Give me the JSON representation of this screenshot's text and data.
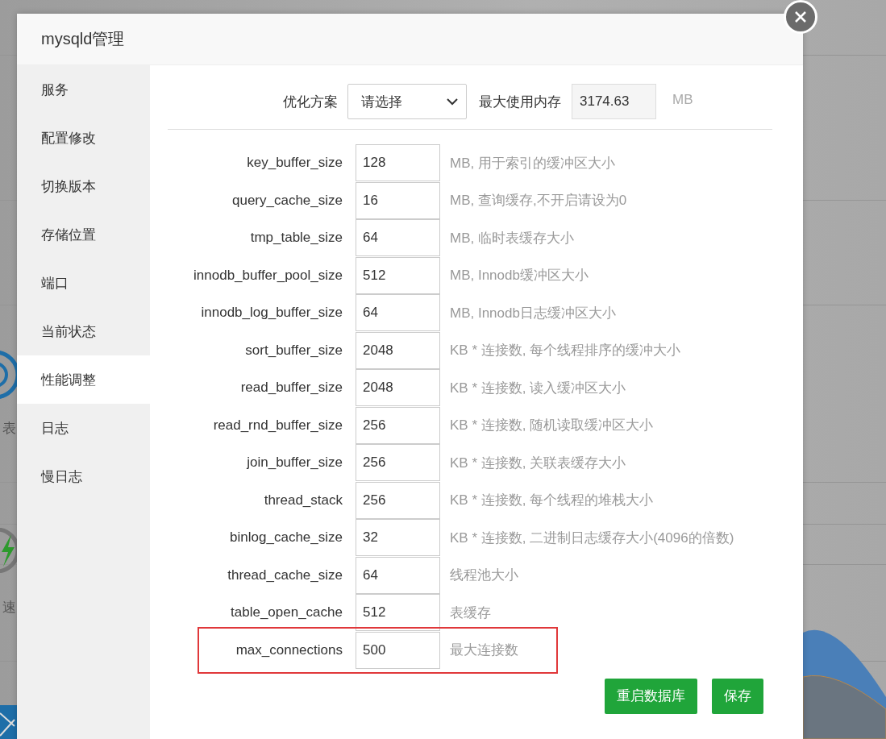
{
  "background": {
    "labels": [
      "表",
      "速"
    ]
  },
  "dialog": {
    "title": "mysqld管理"
  },
  "sidebar": {
    "items": [
      {
        "label": "服务",
        "selected": false
      },
      {
        "label": "配置修改",
        "selected": false
      },
      {
        "label": "切换版本",
        "selected": false
      },
      {
        "label": "存储位置",
        "selected": false
      },
      {
        "label": "端口",
        "selected": false
      },
      {
        "label": "当前状态",
        "selected": false
      },
      {
        "label": "性能调整",
        "selected": true
      },
      {
        "label": "日志",
        "selected": false
      },
      {
        "label": "慢日志",
        "selected": false
      }
    ]
  },
  "toolbar": {
    "scheme_label": "优化方案",
    "scheme_value": "请选择",
    "memory_label": "最大使用内存",
    "memory_value": "3174.63",
    "memory_unit": "MB"
  },
  "params": [
    {
      "name": "key_buffer_size",
      "value": "128",
      "description": "MB, 用于索引的缓冲区大小",
      "highlighted": false
    },
    {
      "name": "query_cache_size",
      "value": "16",
      "description": "MB, 查询缓存,不开启请设为0",
      "highlighted": false
    },
    {
      "name": "tmp_table_size",
      "value": "64",
      "description": "MB, 临时表缓存大小",
      "highlighted": false
    },
    {
      "name": "innodb_buffer_pool_size",
      "value": "512",
      "description": "MB, Innodb缓冲区大小",
      "highlighted": false
    },
    {
      "name": "innodb_log_buffer_size",
      "value": "64",
      "description": "MB, Innodb日志缓冲区大小",
      "highlighted": false
    },
    {
      "name": "sort_buffer_size",
      "value": "2048",
      "description": "KB * 连接数, 每个线程排序的缓冲大小",
      "highlighted": false
    },
    {
      "name": "read_buffer_size",
      "value": "2048",
      "description": "KB * 连接数, 读入缓冲区大小",
      "highlighted": false
    },
    {
      "name": "read_rnd_buffer_size",
      "value": "256",
      "description": "KB * 连接数, 随机读取缓冲区大小",
      "highlighted": false
    },
    {
      "name": "join_buffer_size",
      "value": "256",
      "description": "KB * 连接数, 关联表缓存大小",
      "highlighted": false
    },
    {
      "name": "thread_stack",
      "value": "256",
      "description": "KB * 连接数, 每个线程的堆栈大小",
      "highlighted": false
    },
    {
      "name": "binlog_cache_size",
      "value": "32",
      "description": "KB * 连接数, 二进制日志缓存大小(4096的倍数)",
      "highlighted": false
    },
    {
      "name": "thread_cache_size",
      "value": "64",
      "description": "线程池大小",
      "highlighted": false
    },
    {
      "name": "table_open_cache",
      "value": "512",
      "description": "表缓存",
      "highlighted": false
    },
    {
      "name": "max_connections",
      "value": "500",
      "description": "最大连接数",
      "highlighted": true
    }
  ],
  "buttons": [
    "重启数据库",
    "保存"
  ]
}
